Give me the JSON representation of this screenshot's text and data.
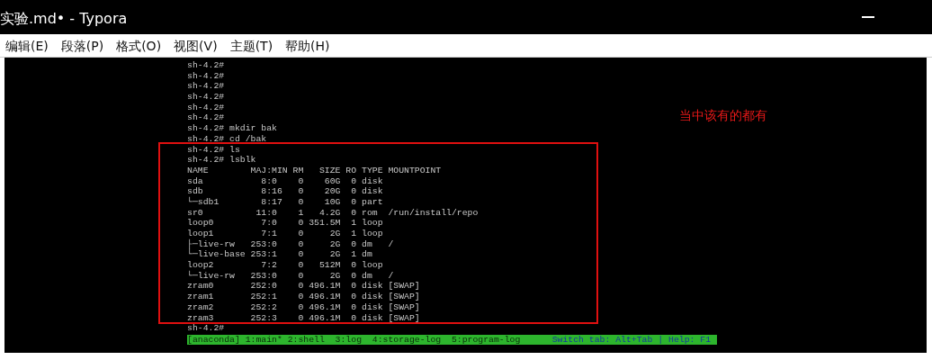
{
  "window": {
    "title": "实验.md• - Typora"
  },
  "menu": [
    "编辑(E)",
    "段落(P)",
    "格式(O)",
    "视图(V)",
    "主题(T)",
    "帮助(H)"
  ],
  "terminal": {
    "lines": [
      "sh-4.2#",
      "sh-4.2#",
      "sh-4.2#",
      "sh-4.2#",
      "sh-4.2#",
      "sh-4.2#",
      "sh-4.2# mkdir bak",
      "sh-4.2# cd /bak",
      "sh-4.2# ls",
      "sh-4.2# lsblk",
      "NAME        MAJ:MIN RM   SIZE RO TYPE MOUNTPOINT",
      "sda           8:0    0    60G  0 disk",
      "sdb           8:16   0    20G  0 disk",
      "└─sdb1        8:17   0    10G  0 part",
      "sr0          11:0    1   4.2G  0 rom  /run/install/repo",
      "loop0         7:0    0 351.5M  1 loop",
      "loop1         7:1    0     2G  1 loop",
      "├─live-rw   253:0    0     2G  0 dm   /",
      "└─live-base 253:1    0     2G  1 dm",
      "loop2         7:2    0   512M  0 loop",
      "└─live-rw   253:0    0     2G  0 dm   /",
      "zram0       252:0    0 496.1M  0 disk [SWAP]",
      "zram1       252:1    0 496.1M  0 disk [SWAP]",
      "zram2       252:2    0 496.1M  0 disk [SWAP]",
      "zram3       252:3    0 496.1M  0 disk [SWAP]",
      "sh-4.2#"
    ],
    "status_bar": {
      "tabs": "[anaconda] 1:main* 2:shell  3:log  4:storage-log  5:program-log",
      "help": "Switch tab: Alt+Tab | Help: F1"
    }
  },
  "annotation": {
    "text": "当中该有的都有"
  }
}
